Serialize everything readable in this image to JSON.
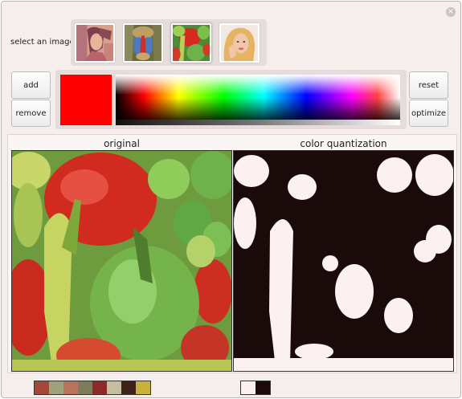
{
  "header": {
    "select_label": "select an image",
    "close_icon": "close-icon"
  },
  "thumbnails": [
    {
      "name": "woman-portrait",
      "selected": false
    },
    {
      "name": "mandrill",
      "selected": false
    },
    {
      "name": "peppers",
      "selected": true
    },
    {
      "name": "blonde-portrait",
      "selected": false
    }
  ],
  "buttons": {
    "add": "add",
    "remove": "remove",
    "reset": "reset",
    "optimize": "optimize"
  },
  "picker": {
    "current_color": "#ff0000"
  },
  "panels": {
    "original_title": "original",
    "quantized_title": "color quantization"
  },
  "original_palette": [
    "#a2493a",
    "#9fa27a",
    "#b6745c",
    "#7f7b5d",
    "#8c2b25",
    "#c5bfa2",
    "#3d2318",
    "#c7b240"
  ],
  "quantized_palette": [
    "#fbf1f0",
    "#1a0a0a"
  ]
}
